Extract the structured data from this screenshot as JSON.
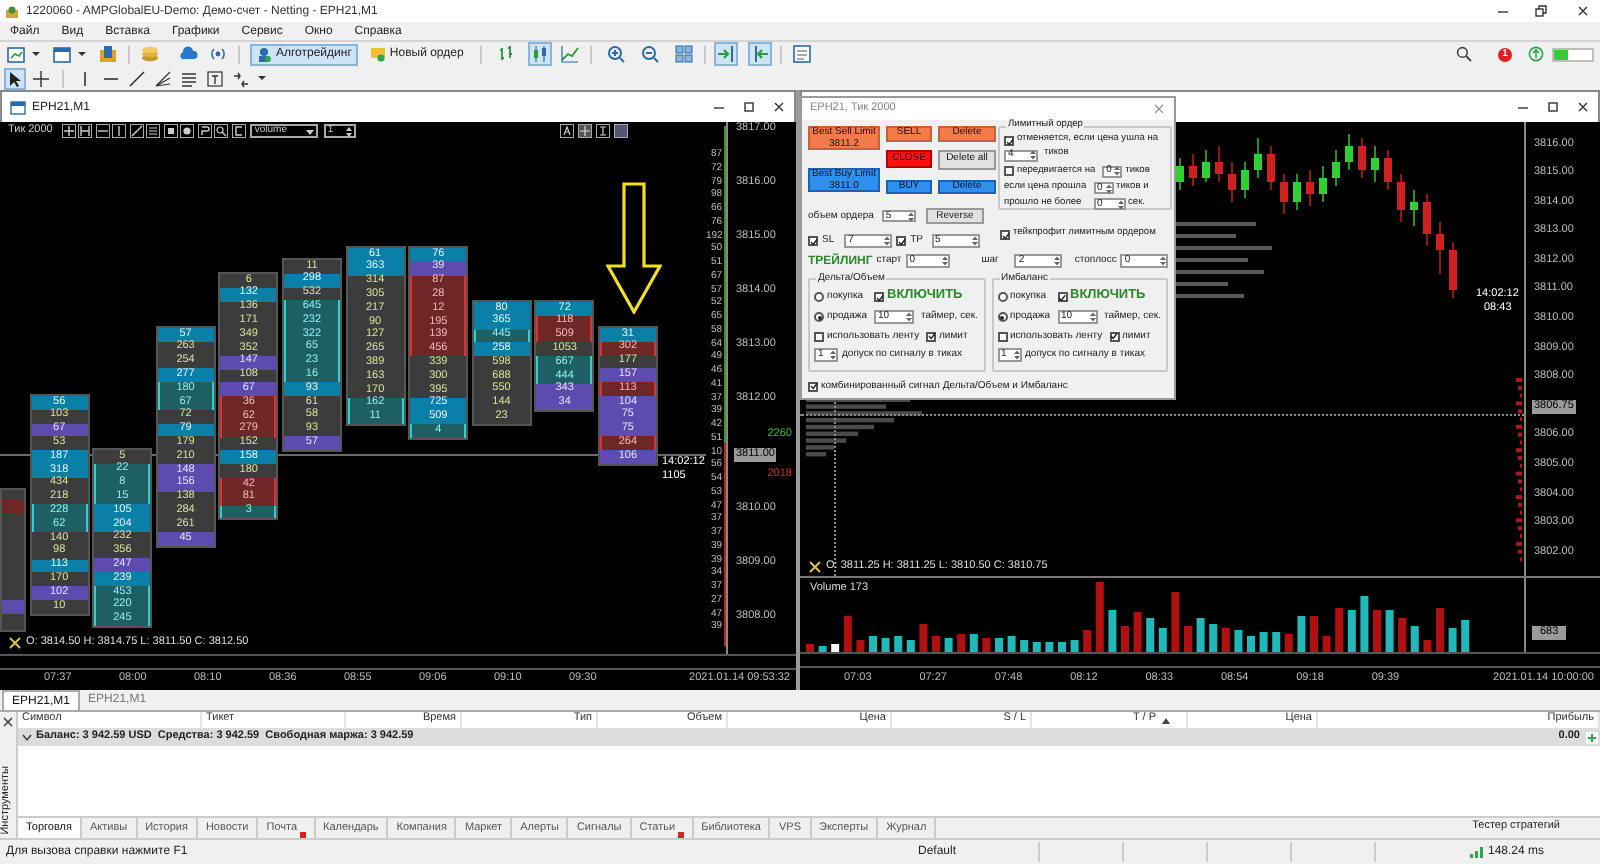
{
  "window": {
    "title": "1220060 - AMPGlobalEU-Demo: Демо-счет - Netting - EPH21,M1"
  },
  "menu": [
    "Файл",
    "Вид",
    "Вставка",
    "Графики",
    "Сервис",
    "Окно",
    "Справка"
  ],
  "toolbar": {
    "buttons": [
      {
        "label": "Алготрейдинг",
        "pressed": true
      },
      {
        "label": "Новый ордер",
        "pressed": false
      }
    ],
    "notifications": "1"
  },
  "left_chart": {
    "title": "EPH21,M1",
    "period_label": "Тик 2000",
    "mode": "volume",
    "step": "1",
    "footprint": [
      {
        "cells": [
          {
            "text": "56",
            "kind": "blue"
          },
          {
            "text": "103",
            "kind": "plain"
          },
          {
            "text": "67",
            "kind": "purple"
          },
          {
            "text": "53",
            "kind": "plain"
          },
          {
            "text": "187",
            "kind": "blue"
          },
          {
            "text": "318",
            "kind": "blue"
          },
          {
            "text": "434",
            "kind": "plain"
          },
          {
            "text": "218",
            "kind": "plain"
          },
          {
            "text": "228",
            "kind": "teal"
          },
          {
            "text": "62",
            "kind": "teal"
          },
          {
            "text": "140",
            "kind": "plain"
          },
          {
            "text": "98",
            "kind": "plain"
          },
          {
            "text": "113",
            "kind": "blue"
          },
          {
            "text": "170",
            "kind": "plain"
          },
          {
            "text": "102",
            "kind": "purple"
          },
          {
            "text": "10",
            "kind": "plain"
          }
        ]
      },
      {
        "cells": [
          {
            "text": "5",
            "kind": "plain"
          },
          {
            "text": "22",
            "kind": "teal"
          },
          {
            "text": "8",
            "kind": "teal"
          },
          {
            "text": "15",
            "kind": "teal"
          },
          {
            "text": "105",
            "kind": "blue"
          },
          {
            "text": "204",
            "kind": "blue"
          },
          {
            "text": "232",
            "kind": "plain"
          },
          {
            "text": "356",
            "kind": "plain"
          },
          {
            "text": "247",
            "kind": "purple"
          },
          {
            "text": "239",
            "kind": "blue"
          },
          {
            "text": "453",
            "kind": "teal"
          },
          {
            "text": "220",
            "kind": "teal"
          },
          {
            "text": "245",
            "kind": "teal"
          }
        ]
      },
      {
        "cells": [
          {
            "text": "57",
            "kind": "blue"
          },
          {
            "text": "263",
            "kind": "plain"
          },
          {
            "text": "254",
            "kind": "plain"
          },
          {
            "text": "277",
            "kind": "blue"
          },
          {
            "text": "180",
            "kind": "teal"
          },
          {
            "text": "67",
            "kind": "teal"
          },
          {
            "text": "72",
            "kind": "plain"
          },
          {
            "text": "79",
            "kind": "blue"
          },
          {
            "text": "179",
            "kind": "plain"
          },
          {
            "text": "210",
            "kind": "plain"
          },
          {
            "text": "148",
            "kind": "purple"
          },
          {
            "text": "156",
            "kind": "purple"
          },
          {
            "text": "138",
            "kind": "plain"
          },
          {
            "text": "284",
            "kind": "plain"
          },
          {
            "text": "261",
            "kind": "plain"
          },
          {
            "text": "45",
            "kind": "purple"
          }
        ]
      },
      {
        "cells": [
          {
            "text": "6",
            "kind": "plain"
          },
          {
            "text": "132",
            "kind": "blue"
          },
          {
            "text": "136",
            "kind": "plain"
          },
          {
            "text": "171",
            "kind": "plain"
          },
          {
            "text": "349",
            "kind": "plain"
          },
          {
            "text": "352",
            "kind": "plain"
          },
          {
            "text": "147",
            "kind": "purple"
          },
          {
            "text": "108",
            "kind": "plain"
          },
          {
            "text": "67",
            "kind": "purple"
          },
          {
            "text": "36",
            "kind": "red"
          },
          {
            "text": "62",
            "kind": "red"
          },
          {
            "text": "279",
            "kind": "red"
          },
          {
            "text": "152",
            "kind": "plain"
          },
          {
            "text": "158",
            "kind": "blue"
          },
          {
            "text": "180",
            "kind": "plain"
          },
          {
            "text": "42",
            "kind": "red"
          },
          {
            "text": "81",
            "kind": "red"
          },
          {
            "text": "3",
            "kind": "teal"
          }
        ]
      },
      {
        "cells": [
          {
            "text": "11",
            "kind": "plain"
          },
          {
            "text": "298",
            "kind": "blue"
          },
          {
            "text": "532",
            "kind": "plain"
          },
          {
            "text": "645",
            "kind": "teal"
          },
          {
            "text": "232",
            "kind": "teal"
          },
          {
            "text": "322",
            "kind": "teal"
          },
          {
            "text": "65",
            "kind": "teal"
          },
          {
            "text": "23",
            "kind": "teal"
          },
          {
            "text": "16",
            "kind": "teal"
          },
          {
            "text": "93",
            "kind": "blue"
          },
          {
            "text": "61",
            "kind": "plain"
          },
          {
            "text": "58",
            "kind": "plain"
          },
          {
            "text": "93",
            "kind": "plain"
          },
          {
            "text": "57",
            "kind": "purple"
          }
        ]
      },
      {
        "cells": [
          {
            "text": "61",
            "kind": "blue"
          },
          {
            "text": "363",
            "kind": "blue"
          },
          {
            "text": "314",
            "kind": "plain"
          },
          {
            "text": "305",
            "kind": "plain"
          },
          {
            "text": "217",
            "kind": "plain"
          },
          {
            "text": "90",
            "kind": "plain"
          },
          {
            "text": "127",
            "kind": "plain"
          },
          {
            "text": "265",
            "kind": "plain"
          },
          {
            "text": "389",
            "kind": "plain"
          },
          {
            "text": "163",
            "kind": "plain"
          },
          {
            "text": "170",
            "kind": "plain"
          },
          {
            "text": "162",
            "kind": "teal"
          },
          {
            "text": "11",
            "kind": "teal"
          }
        ]
      },
      {
        "cells": [
          {
            "text": "76",
            "kind": "blue"
          },
          {
            "text": "39",
            "kind": "purple"
          },
          {
            "text": "87",
            "kind": "red"
          },
          {
            "text": "28",
            "kind": "red"
          },
          {
            "text": "12",
            "kind": "red"
          },
          {
            "text": "195",
            "kind": "red"
          },
          {
            "text": "139",
            "kind": "red"
          },
          {
            "text": "456",
            "kind": "red"
          },
          {
            "text": "339",
            "kind": "plain"
          },
          {
            "text": "300",
            "kind": "plain"
          },
          {
            "text": "395",
            "kind": "plain"
          },
          {
            "text": "725",
            "kind": "blue"
          },
          {
            "text": "509",
            "kind": "blue"
          },
          {
            "text": "4",
            "kind": "teal"
          }
        ]
      },
      {
        "cells": [
          {
            "text": "80",
            "kind": "blue"
          },
          {
            "text": "365",
            "kind": "blue"
          },
          {
            "text": "445",
            "kind": "teal"
          },
          {
            "text": "258",
            "kind": "blue"
          },
          {
            "text": "598",
            "kind": "plain"
          },
          {
            "text": "688",
            "kind": "plain"
          },
          {
            "text": "550",
            "kind": "plain"
          },
          {
            "text": "144",
            "kind": "plain"
          },
          {
            "text": "23",
            "kind": "plain"
          }
        ]
      },
      {
        "cells": [
          {
            "text": "72",
            "kind": "blue"
          },
          {
            "text": "118",
            "kind": "red"
          },
          {
            "text": "509",
            "kind": "red"
          },
          {
            "text": "1053",
            "kind": "plain"
          },
          {
            "text": "667",
            "kind": "teal"
          },
          {
            "text": "444",
            "kind": "teal"
          },
          {
            "text": "343",
            "kind": "purple"
          },
          {
            "text": "34",
            "kind": "purple"
          }
        ]
      },
      {
        "cells": [
          {
            "text": "31",
            "kind": "blue"
          },
          {
            "text": "302",
            "kind": "red"
          },
          {
            "text": "177",
            "kind": "plain"
          },
          {
            "text": "157",
            "kind": "purple"
          },
          {
            "text": "113",
            "kind": "red"
          },
          {
            "text": "104",
            "kind": "purple"
          },
          {
            "text": "75",
            "kind": "purple"
          },
          {
            "text": "75",
            "kind": "purple"
          },
          {
            "text": "264",
            "kind": "red"
          },
          {
            "text": "106",
            "kind": "purple"
          }
        ]
      }
    ],
    "profile": [
      "87",
      "72",
      "79",
      "98",
      "66",
      "76",
      "192",
      "50",
      "51",
      "67",
      "57",
      "52",
      "65",
      "58",
      "64",
      "49",
      "46",
      "41",
      "37",
      "39",
      "42",
      "51",
      "10",
      "56",
      "54",
      "53",
      "47",
      "37",
      "37",
      "39",
      "39",
      "34",
      "37",
      "27",
      "47",
      "39"
    ],
    "price_labels": [
      {
        "text": "3817.00",
        "current": false
      },
      {
        "text": "3816.00",
        "current": false
      },
      {
        "text": "3815.00",
        "current": false
      },
      {
        "text": "3814.00",
        "current": false
      },
      {
        "text": "3813.00",
        "current": false
      },
      {
        "text": "3812.00",
        "current": false
      },
      {
        "text": "3811.00",
        "current": true
      },
      {
        "text": "3810.00",
        "current": false
      },
      {
        "text": "3809.00",
        "current": false
      },
      {
        "text": "3808.00",
        "current": false
      }
    ],
    "ask_volume": "2260",
    "bid_volume": "2018",
    "last_time": "14:02:12",
    "last_volume": "1105",
    "ohlc": "O: 3814.50 H: 3814.75 L: 3811.50 C: 3812.50",
    "time_labels": [
      "07:37",
      "08:00",
      "08:10",
      "08:36",
      "08:55",
      "09:06",
      "09:10",
      "09:30"
    ],
    "date_label": "2021.01.14 09:53:32"
  },
  "right_chart": {
    "price_labels": [
      {
        "text": "3816.00",
        "current": false
      },
      {
        "text": "3815.00",
        "current": false
      },
      {
        "text": "3814.00",
        "current": false
      },
      {
        "text": "3813.00",
        "current": false
      },
      {
        "text": "3812.00",
        "current": false
      },
      {
        "text": "3811.00",
        "current": false
      },
      {
        "text": "3810.00",
        "current": false
      },
      {
        "text": "3809.00",
        "current": false
      },
      {
        "text": "3808.00",
        "current": false
      },
      {
        "text": "3806.75",
        "current": true
      },
      {
        "text": "3806.00",
        "current": false
      },
      {
        "text": "3805.00",
        "current": false
      },
      {
        "text": "3804.00",
        "current": false
      },
      {
        "text": "3803.00",
        "current": false
      },
      {
        "text": "3802.00",
        "current": false
      }
    ],
    "last_time": "14:02:12",
    "last_bar_time": "08:43",
    "ohlc": "O: 3811.25 H: 3811.25 L: 3810.50 C: 3810.75",
    "volume_label": "Volume 173",
    "volume_value": "683",
    "time_labels": [
      "07:03",
      "07:27",
      "07:48",
      "08:12",
      "08:33",
      "08:54",
      "09:18",
      "09:39"
    ],
    "date_label": "2021.01.14 10:00:00"
  },
  "order_panel": {
    "title": "EPH21, Тик 2000",
    "buttons": [
      {
        "label": "Best Sell Limit 3811.2",
        "kind": "sell"
      },
      {
        "label": "SELL",
        "kind": "sell"
      },
      {
        "label": "Delete",
        "kind": "sell"
      },
      {
        "label": "CLOSE",
        "kind": "close"
      },
      {
        "label": "Delete all",
        "kind": "neutral"
      },
      {
        "label": "Best Buy Limit 3811.0",
        "kind": "buy"
      },
      {
        "label": "BUY",
        "kind": "buy"
      },
      {
        "label": "Delete",
        "kind": "buy"
      }
    ],
    "order_volume": {
      "label": "объем ордера",
      "value": "5"
    },
    "reverse": "Reverse",
    "sl": {
      "label": "SL",
      "checked": true,
      "value": "7"
    },
    "tp": {
      "label": "TP",
      "checked": true,
      "value": "5"
    },
    "trailing": {
      "title": "ТРЕЙЛИНГ",
      "start_label": "старт",
      "start": "0",
      "step_label": "шаг",
      "step": "2",
      "stop_label": "стоплосс",
      "stop": "0"
    },
    "limit_order": {
      "title": "Лимитный ордер",
      "cancel": {
        "label": "отменяется, если цена ушла на",
        "checked": true,
        "value": "4",
        "unit": "тиков"
      },
      "move": {
        "label": "передвигается на",
        "checked": false,
        "value": "0",
        "unit": "тиков"
      },
      "passed": {
        "label": "если цена прошла",
        "value": "0",
        "unit": "тиков и"
      },
      "elapsed": {
        "label": "прошло не более",
        "value": "0",
        "unit": "сек."
      }
    },
    "take_profit_limit": {
      "label": "тейкпрофит лимитным ордером",
      "checked": true
    },
    "groups": [
      {
        "title": "Дельта/Объем",
        "buy": {
          "label": "покупка",
          "selected": false
        },
        "enable": {
          "label": "ВКЛЮЧИТЬ",
          "checked": true
        },
        "sell": {
          "label": "продажа",
          "selected": true
        },
        "timer": {
          "value": "10",
          "label": "таймер, сек."
        },
        "use_tape": {
          "label": "использовать ленту",
          "checked": false
        },
        "limit": {
          "label": "лимит",
          "checked": true
        },
        "tolerance": {
          "value": "1",
          "label": "допуск по сигналу в тиках"
        }
      },
      {
        "title": "Имбаланс",
        "buy": {
          "label": "покупка",
          "selected": false
        },
        "enable": {
          "label": "ВКЛЮЧИТЬ",
          "checked": true
        },
        "sell": {
          "label": "продажа",
          "selected": true
        },
        "timer": {
          "value": "10",
          "label": "таймер, сек."
        },
        "use_tape": {
          "label": "использовать ленту",
          "checked": false
        },
        "limit": {
          "label": "лимит",
          "checked": true
        },
        "tolerance": {
          "value": "1",
          "label": "допуск по сигналу в тиках"
        }
      }
    ],
    "combined": {
      "label": "комбинированный сигнал Дельта/Объем и Имбаланс",
      "checked": true
    }
  },
  "chart_tabs": [
    {
      "label": "EPH21,M1",
      "selected": true
    },
    {
      "label": "EPH21,M1",
      "selected": false
    }
  ],
  "toolbox": {
    "side_label": "Инструменты",
    "columns": [
      {
        "label": "Символ",
        "sorted": false
      },
      {
        "label": "Тикет",
        "sorted": false
      },
      {
        "label": "Время",
        "sorted": false
      },
      {
        "label": "Тип",
        "sorted": false
      },
      {
        "label": "Объем",
        "sorted": false
      },
      {
        "label": "Цена",
        "sorted": false
      },
      {
        "label": "S / L",
        "sorted": false
      },
      {
        "label": "T / P",
        "sorted": true
      },
      {
        "label": "Цена",
        "sorted": false
      },
      {
        "label": "Прибыль",
        "sorted": false
      }
    ],
    "balance": "Баланс: 3 942.59 USD  Средства: 3 942.59  Свободная маржа: 3 942.59",
    "profit": "0.00",
    "tabs": [
      {
        "label": "Торговля",
        "selected": true,
        "notification": false
      },
      {
        "label": "Активы",
        "selected": false,
        "notification": false
      },
      {
        "label": "История",
        "selected": false,
        "notification": false
      },
      {
        "label": "Новости",
        "selected": false,
        "notification": false
      },
      {
        "label": "Почта",
        "selected": false,
        "notification": true
      },
      {
        "label": "Календарь",
        "selected": false,
        "notification": false
      },
      {
        "label": "Компания",
        "selected": false,
        "notification": false
      },
      {
        "label": "Маркет",
        "selected": false,
        "notification": false
      },
      {
        "label": "Алерты",
        "selected": false,
        "notification": false
      },
      {
        "label": "Сигналы",
        "selected": false,
        "notification": false
      },
      {
        "label": "Статьи",
        "selected": false,
        "notification": true
      },
      {
        "label": "Библиотека",
        "selected": false,
        "notification": false
      },
      {
        "label": "VPS",
        "selected": false,
        "notification": false
      },
      {
        "label": "Эксперты",
        "selected": false,
        "notification": false
      },
      {
        "label": "Журнал",
        "selected": false,
        "notification": false
      }
    ],
    "tester": "Тестер стратегий"
  },
  "status_bar": {
    "help": "Для вызова справки нажмите F1",
    "profile": "Default",
    "ping": "148.24 ms"
  }
}
